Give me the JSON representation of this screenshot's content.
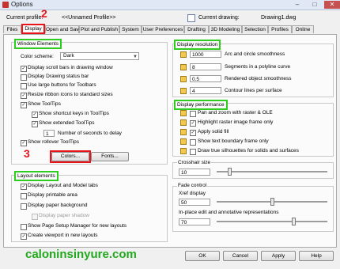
{
  "window": {
    "title": "Options",
    "minimize": "–",
    "maximize": "□",
    "close": "✕"
  },
  "header": {
    "current_profile_label": "Current profile:",
    "current_profile_value": "<<Unnamed Profile>>",
    "current_drawing_label": "Current drawing:",
    "current_drawing_value": "Drawing1.dwg"
  },
  "tabs": [
    "Files",
    "Display",
    "Open and Save",
    "Plot and Publish",
    "System",
    "User Preferences",
    "Drafting",
    "3D Modeling",
    "Selection",
    "Profiles",
    "Online"
  ],
  "active_tab": "Display",
  "window_elements": {
    "title": "Window Elements",
    "color_scheme_label": "Color scheme:",
    "color_scheme_value": "Dark",
    "options": [
      {
        "label": "Display scroll bars in drawing window",
        "checked": true,
        "enabled": true
      },
      {
        "label": "Display Drawing status bar",
        "checked": false,
        "enabled": true
      },
      {
        "label": "Use large buttons for Toolbars",
        "checked": false,
        "enabled": true
      },
      {
        "label": "Resize ribbon icons to standard sizes",
        "checked": true,
        "enabled": true
      },
      {
        "label": "Show ToolTips",
        "checked": true,
        "enabled": true
      },
      {
        "label": "Show shortcut keys in ToolTips",
        "checked": true,
        "enabled": true
      },
      {
        "label": "Show extended ToolTips",
        "checked": true,
        "enabled": true
      }
    ],
    "delay_value": "1",
    "delay_label": "Number of seconds to delay",
    "rollover_label": "Show rollover ToolTips",
    "rollover_checked": true,
    "colors_button": "Colors...",
    "fonts_button": "Fonts..."
  },
  "layout_elements": {
    "title": "Layout elements",
    "options": [
      {
        "label": "Display Layout and Model tabs",
        "checked": true,
        "enabled": true
      },
      {
        "label": "Display printable area",
        "checked": false,
        "enabled": true
      },
      {
        "label": "Display paper background",
        "checked": false,
        "enabled": true
      },
      {
        "label": "Display paper shadow",
        "checked": false,
        "enabled": false
      },
      {
        "label": "Show Page Setup Manager for new layouts",
        "checked": false,
        "enabled": true
      },
      {
        "label": "Create viewport in new layouts",
        "checked": true,
        "enabled": true
      }
    ]
  },
  "display_resolution": {
    "title": "Display resolution",
    "rows": [
      {
        "value": "1000",
        "label": "Arc and circle smoothness"
      },
      {
        "value": "8",
        "label": "Segments in a polyline curve"
      },
      {
        "value": "0.5",
        "label": "Rendered object smoothness"
      },
      {
        "value": "4",
        "label": "Contour lines per surface"
      }
    ]
  },
  "display_performance": {
    "title": "Display performance",
    "options": [
      {
        "label": "Pan and zoom with raster & OLE",
        "checked": false
      },
      {
        "label": "Highlight raster image frame only",
        "checked": true
      },
      {
        "label": "Apply solid fill",
        "checked": true
      },
      {
        "label": "Show text boundary frame only",
        "checked": false
      },
      {
        "label": "Draw true silhouettes for solids and surfaces",
        "checked": false
      }
    ]
  },
  "crosshair": {
    "label": "Crosshair size",
    "value": "10",
    "fraction": 0.1
  },
  "fade_control": {
    "title": "Fade control",
    "xref_label": "Xref display",
    "xref_value": "50",
    "xref_fraction": 0.5,
    "inplace_label": "In-place edit and annotative representations",
    "inplace_value": "70",
    "inplace_fraction": 0.7
  },
  "annotations": {
    "step2": "2",
    "step3": "3"
  },
  "watermark": "caloninsinyure.com",
  "footer": {
    "ok": "OK",
    "cancel": "Cancel",
    "apply": "Apply",
    "help": "Help"
  }
}
